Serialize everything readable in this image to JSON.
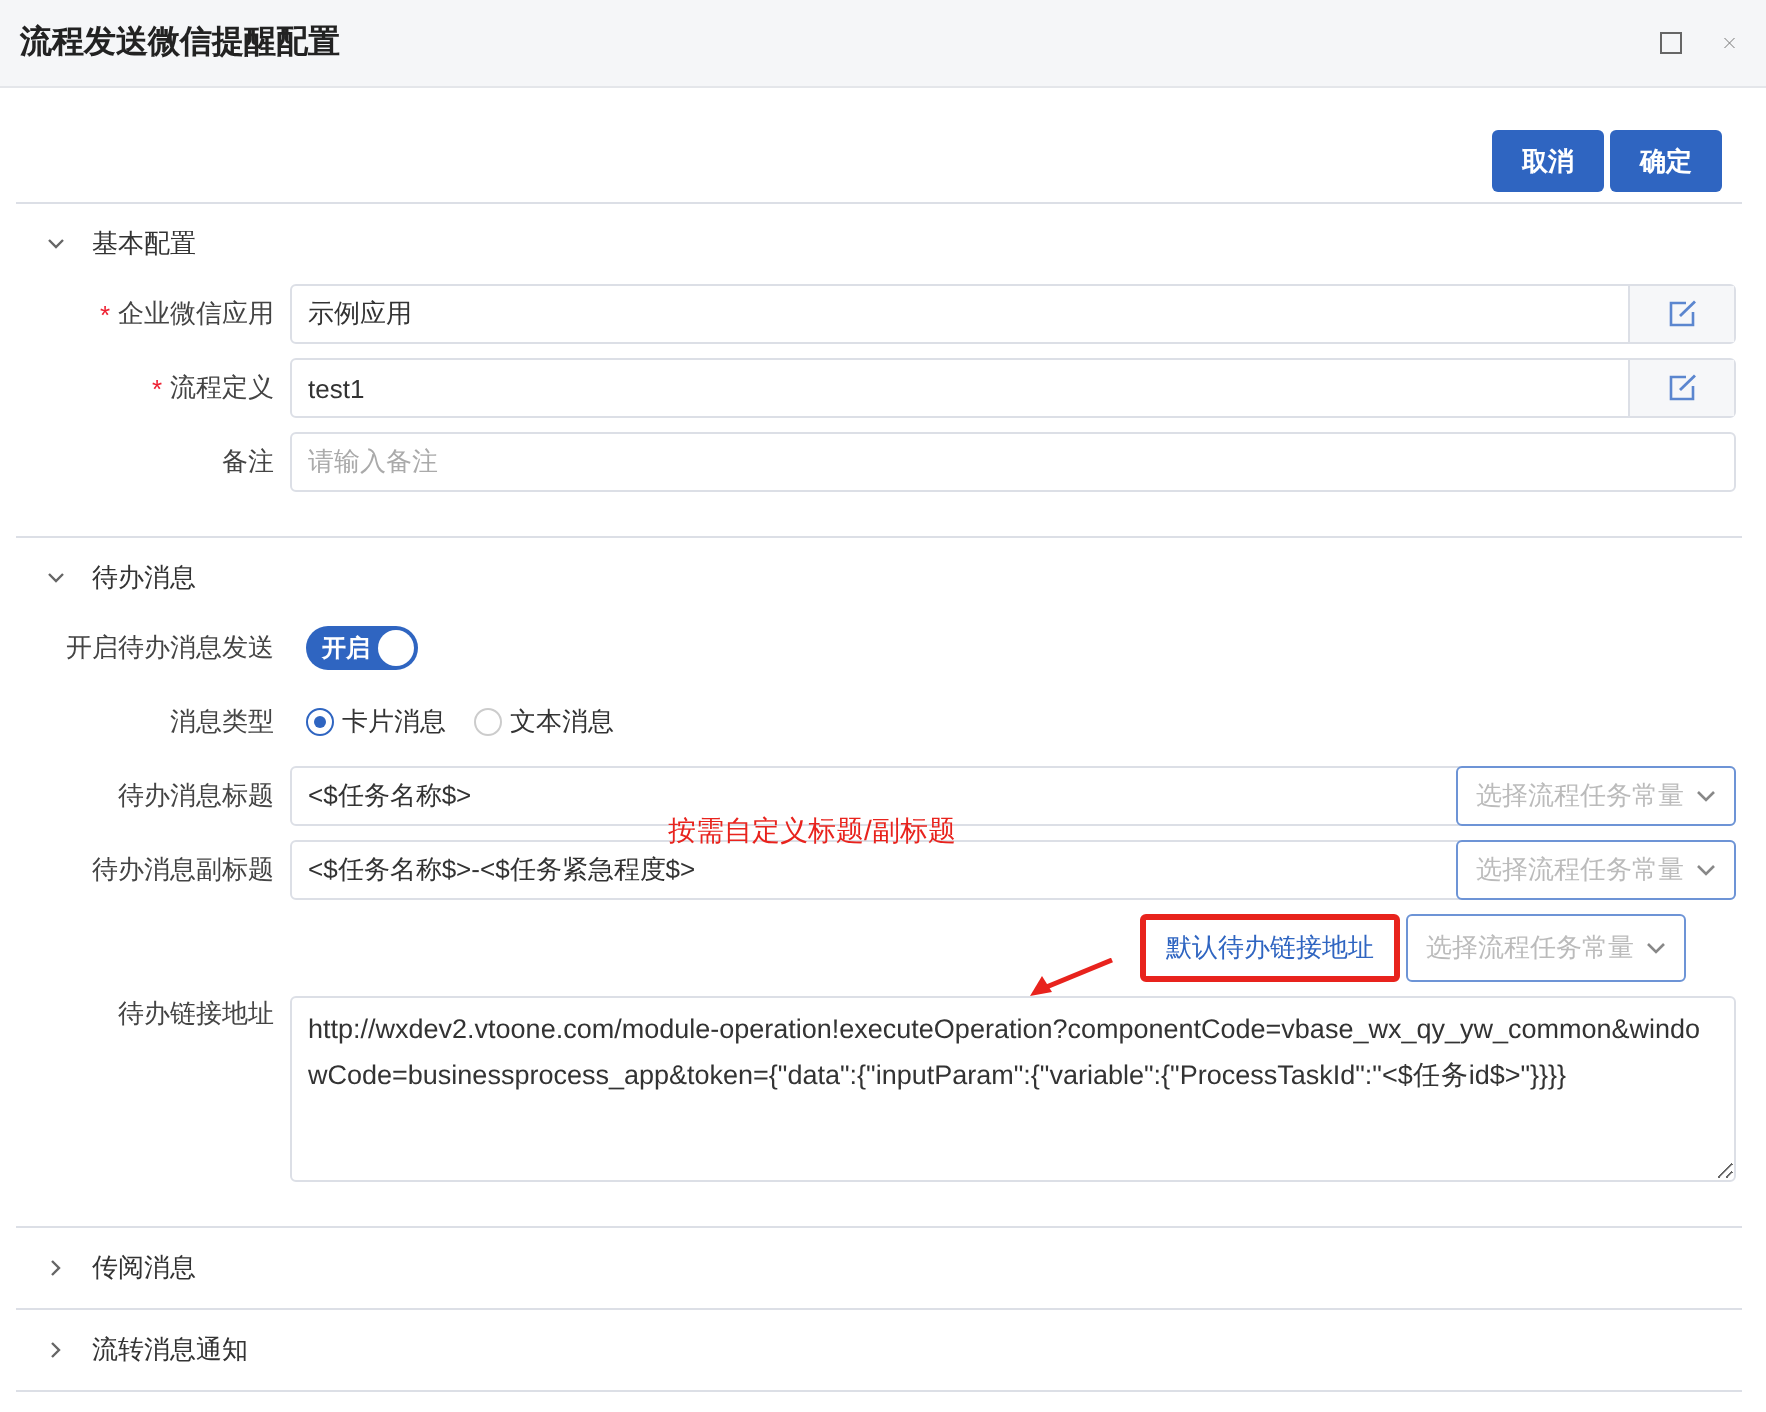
{
  "window": {
    "title": "流程发送微信提醒配置"
  },
  "actions": [
    {
      "label": "取消"
    },
    {
      "label": "确定"
    }
  ],
  "sections": [
    {
      "title": "基本配置",
      "expanded": true,
      "fields": [
        {
          "kind": "lookup",
          "label": "企业微信应用",
          "required_mark": "*",
          "value": "示例应用"
        },
        {
          "kind": "lookup",
          "label": "流程定义",
          "required_mark": "*",
          "value": "test1"
        },
        {
          "kind": "text",
          "label": "备注",
          "placeholder": "请输入备注"
        }
      ]
    },
    {
      "title": "待办消息",
      "expanded": true,
      "fields": [
        {
          "kind": "switch",
          "label": "开启待办消息发送",
          "on": true,
          "text": "开启"
        },
        {
          "kind": "radio",
          "label": "消息类型",
          "options": [
            {
              "label": "卡片消息",
              "selected": true
            },
            {
              "label": "文本消息",
              "selected": false
            }
          ]
        },
        {
          "kind": "select",
          "label": "待办消息标题",
          "value": "<$任务名称$>",
          "select": "选择流程任务常量"
        },
        {
          "kind": "select",
          "label": "待办消息副标题",
          "value": "<$任务名称$>-<$任务紧急程度$>",
          "select": "选择流程任务常量"
        },
        {
          "kind": "buttons",
          "button": "默认待办链接地址",
          "highlighted": true,
          "select": "选择流程任务常量"
        },
        {
          "kind": "textarea",
          "label": "待办链接地址",
          "value": "http://wxdev2.vtoone.com/module-operation!executeOperation?componentCode=vbase_wx_qy_yw_common&windowCode=businessprocess_app&token={\"data\":{\"inputParam\":{\"variable\":{\"ProcessTaskId\":\"<$任务id$>\"}}}}"
        }
      ]
    },
    {
      "title": "传阅消息",
      "expanded": false
    },
    {
      "title": "流转消息通知",
      "expanded": false
    }
  ],
  "annotation": {
    "text": "按需自定义标题/副标题"
  }
}
